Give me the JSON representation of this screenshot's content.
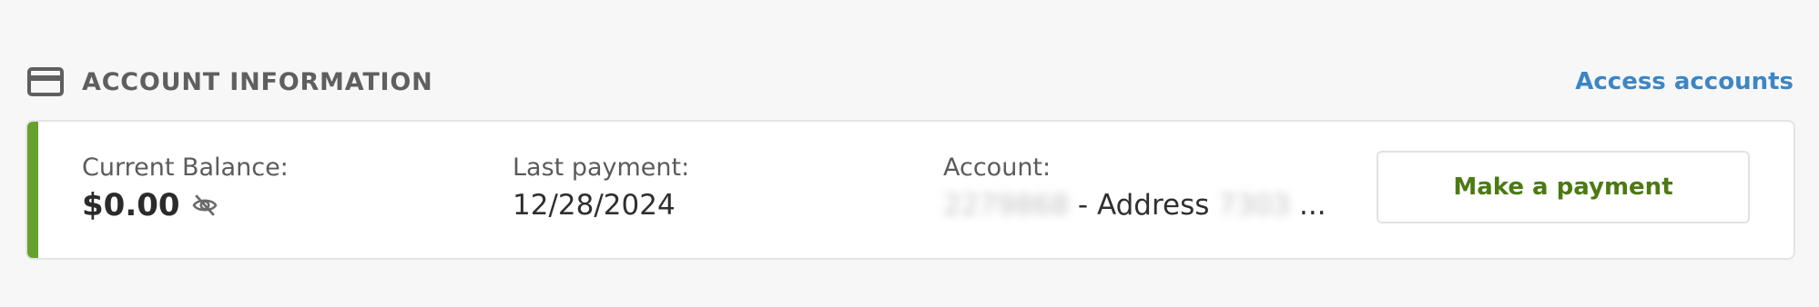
{
  "header": {
    "title": "ACCOUNT INFORMATION",
    "access_link": "Access accounts",
    "icon": "credit-card-icon"
  },
  "fields": {
    "balance": {
      "label": "Current Balance:",
      "value": "$0.00",
      "icon": "eye-off-icon"
    },
    "last_payment": {
      "label": "Last payment:",
      "value": "12/28/2024"
    },
    "account": {
      "label": "Account:",
      "number_masked": "2279868",
      "separator": " - Address ",
      "address_masked": "7303",
      "ellipsis": " ..."
    }
  },
  "actions": {
    "make_payment_label": "Make a payment"
  },
  "colors": {
    "accent": "#66a12d",
    "link": "#3c86c5",
    "button_text": "#4c7a12"
  }
}
